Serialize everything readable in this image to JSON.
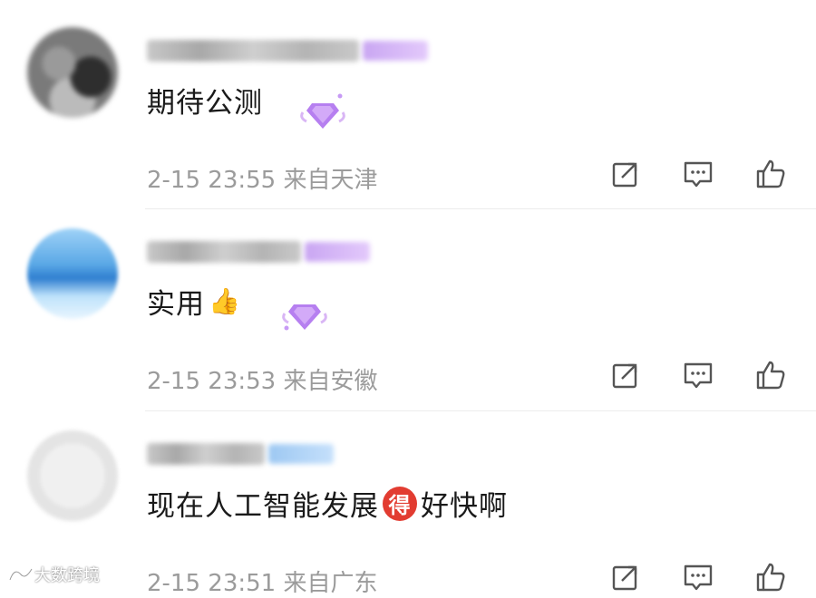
{
  "comments": [
    {
      "text": "期待公测",
      "emoji": "",
      "meta": "2-15 23:55 来自天津",
      "badge_color": "#d9b8f7"
    },
    {
      "text": "实用",
      "emoji": "👍",
      "meta": "2-15 23:53 来自安徽",
      "badge_color": "#d9b8f7"
    },
    {
      "text_before": "现在人工智能发展",
      "badge_char": "得",
      "text_after": "好快啊",
      "meta": "2-15 23:51 来自广东",
      "badge_color": "#b9d8f8"
    }
  ],
  "actions": {
    "icons": [
      "share-icon",
      "comment-icon",
      "like-icon"
    ]
  },
  "watermark": {
    "text": "大数跨境"
  },
  "colors": {
    "text": "#1a1a1a",
    "meta": "#9b9b9b",
    "icon": "#555555",
    "de_badge": "#e23c31"
  }
}
